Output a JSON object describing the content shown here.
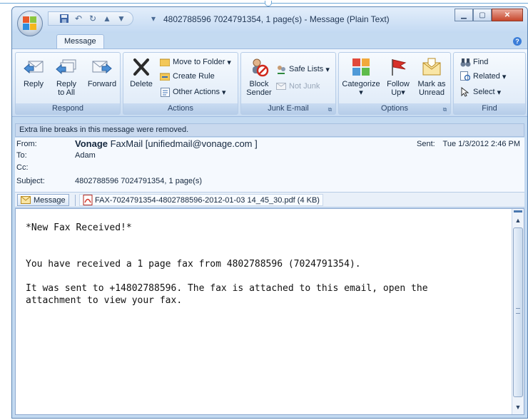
{
  "window": {
    "title": "4802788596 7024791354, 1 page(s) - Message (Plain Text)"
  },
  "tabs": [
    {
      "label": "Message"
    }
  ],
  "ribbon": {
    "respond": {
      "label": "Respond",
      "reply": "Reply",
      "reply_all_1": "Reply",
      "reply_all_2": "to All",
      "forward": "Forward"
    },
    "actions": {
      "label": "Actions",
      "delete": "Delete",
      "move_to_folder": "Move to Folder",
      "create_rule": "Create Rule",
      "other_actions": "Other Actions"
    },
    "junk": {
      "label": "Junk E-mail",
      "block_1": "Block",
      "block_2": "Sender",
      "safe_lists": "Safe Lists",
      "not_junk": "Not Junk"
    },
    "options": {
      "label": "Options",
      "categorize": "Categorize",
      "follow_up_1": "Follow",
      "follow_up_2": "Up",
      "mark_unread_1": "Mark as",
      "mark_unread_2": "Unread"
    },
    "find": {
      "label": "Find",
      "find": "Find",
      "related": "Related",
      "select": "Select"
    }
  },
  "infobar": {
    "text": "Extra line breaks in this message were removed."
  },
  "header": {
    "from_label": "From:",
    "from_name": "Vonage",
    "from_rest": " FaxMail [unifiedmail@vonage.com ]",
    "sent_label": "Sent:",
    "sent_value": "Tue 1/3/2012 2:46 PM",
    "to_label": "To:",
    "to_value": "Adam",
    "cc_label": "Cc:",
    "cc_value": "",
    "subject_label": "Subject:",
    "subject_value": "4802788596 7024791354, 1 page(s)"
  },
  "attachments": {
    "message_label": "Message",
    "file": "FAX-7024791354-4802788596-2012-01-03 14_45_30.pdf (4 KB)"
  },
  "body": {
    "line1": "*New Fax Received!*",
    "line2": "You have received a 1 page fax from 4802788596 (7024791354).",
    "line3": "It was sent to +14802788596. The fax is attached to this email, open the\nattachment to view your fax."
  },
  "colors": {
    "ribbon_bg": "#dbe8f7",
    "window_frame": "#c4daf1",
    "close_button": "#c7472b"
  }
}
